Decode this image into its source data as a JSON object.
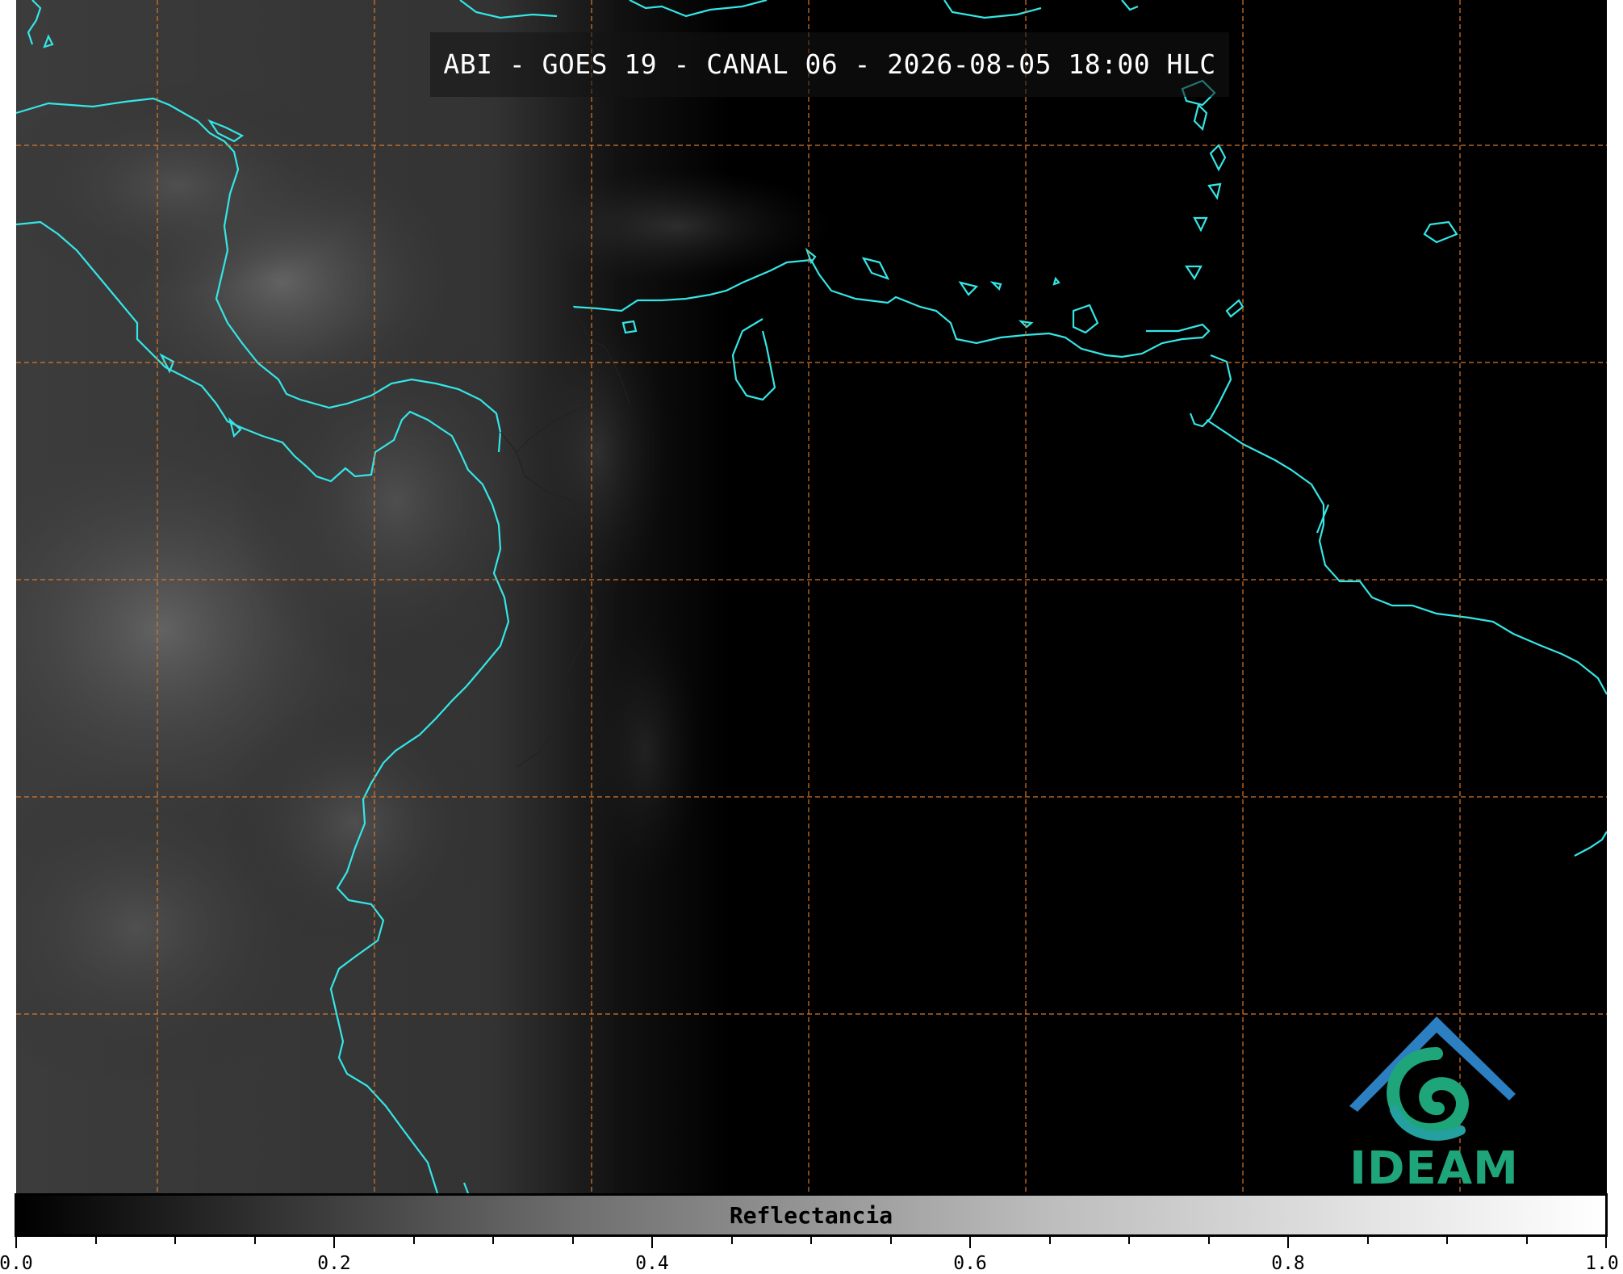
{
  "title": "ABI - GOES 19 - CANAL 06 - 2026-08-05 18:00 HLC",
  "colorbar": {
    "label": "Reflectancia",
    "ticks": [
      "0.0",
      "0.2",
      "0.4",
      "0.6",
      "0.8",
      "1.0"
    ],
    "range": [
      0.0,
      1.0
    ]
  },
  "logo": {
    "text": "IDEAM"
  },
  "colors": {
    "coastline": "#35e6e6",
    "gridlines": "#d9782c",
    "logo_green": "#1fa57a",
    "logo_blue": "#2c7fc0"
  }
}
